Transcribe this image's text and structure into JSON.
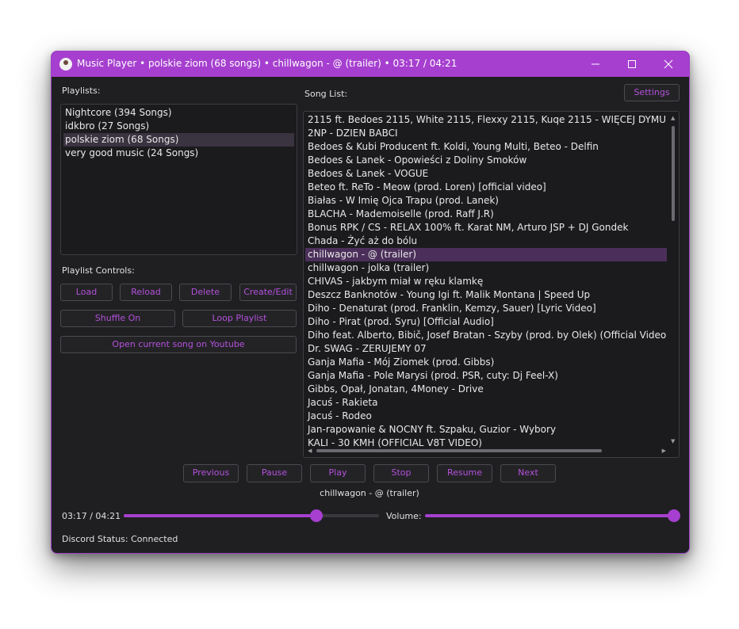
{
  "window": {
    "title": "Music Player • polskie ziom (68 songs) • chillwagon - @ (trailer) • 03:17 / 04:21",
    "accent": "#a63fcf",
    "controls": {
      "minimize": "—",
      "maximize": "☐",
      "close": "✕"
    }
  },
  "playlists": {
    "label": "Playlists:",
    "items": [
      {
        "label": "Nightcore (394 Songs)"
      },
      {
        "label": "idkbro (27 Songs)"
      },
      {
        "label": "polskie ziom (68 Songs)"
      },
      {
        "label": "very good music (24 Songs)"
      }
    ],
    "selected_index": 2
  },
  "playlist_controls": {
    "label": "Playlist Controls:",
    "load": "Load",
    "reload": "Reload",
    "delete": "Delete",
    "create_edit": "Create/Edit",
    "shuffle": "Shuffle On",
    "loop": "Loop Playlist",
    "youtube": "Open current song on Youtube"
  },
  "song_list": {
    "label": "Song List:",
    "settings": "Settings",
    "songs": [
      "2115 ft. Bedoes 2115, White 2115, Flexxy 2115, Kuqe 2115 - WIĘCEJ DYMU",
      "2NP - DZIEN BABCI",
      "Bedoes & Kubi Producent ft. Koldi, Young Multi, Beteo - Delfin",
      "Bedoes & Lanek - Opowieści z Doliny Smoków",
      "Bedoes & Lanek - VOGUE",
      "Beteo ft. ReTo - Meow (prod. Loren) [official video]",
      "Białas - W Imię Ojca Trapu (prod. Lanek)",
      "BLACHA - Mademoiselle  (prod. Raff J.R)",
      "Bonus RPK / CS - RELAX 100% ft. Karat NM, Arturo JSP + DJ Gondek",
      "Chada - Żyć aż do bólu",
      "chillwagon - @ (trailer)",
      "chillwagon - jolka (trailer)",
      "CHIVAS - jakbym miał w ręku klamkę",
      "Deszcz Banknotów - Young Igi ft. Malik Montana  |  Speed Up",
      "Diho - Denaturat (prod. Franklin, Kemzy, Sauer) [Lyric Video]",
      "Diho - Pirat (prod. Syru) [Official Audio]",
      "Diho feat. Alberto, Bibič, Josef Bratan - Szyby (prod. by Olek) (Official Video)",
      "Dr. SWAG - ZERUJEMY 07",
      "Ganja Mafia - Mój Ziomek (prod. Gibbs)",
      "Ganja Mafia - Pole Marysi (prod. PSR, cuty: Dj Feel-X)",
      "Gibbs, Opał, Jonatan, 4Money - Drive",
      "Jacuś - Rakieta",
      "Jacuś - Rodeo",
      "Jan-rapowanie & NOCNY ft. Szpaku, Guzior - Wybory",
      "KALI - 30 KMH (OFFICIAL V8T VIDEO)"
    ],
    "selected_index": 10
  },
  "transport": {
    "previous": "Previous",
    "pause": "Pause",
    "play": "Play",
    "stop": "Stop",
    "resume": "Resume",
    "next": "Next"
  },
  "now_playing": "chillwagon - @ (trailer)",
  "progress": {
    "time": "03:17 / 04:21",
    "fraction": 0.755
  },
  "volume": {
    "label": "Volume:",
    "fraction": 1.0
  },
  "discord_status": "Discord Status: Connected"
}
